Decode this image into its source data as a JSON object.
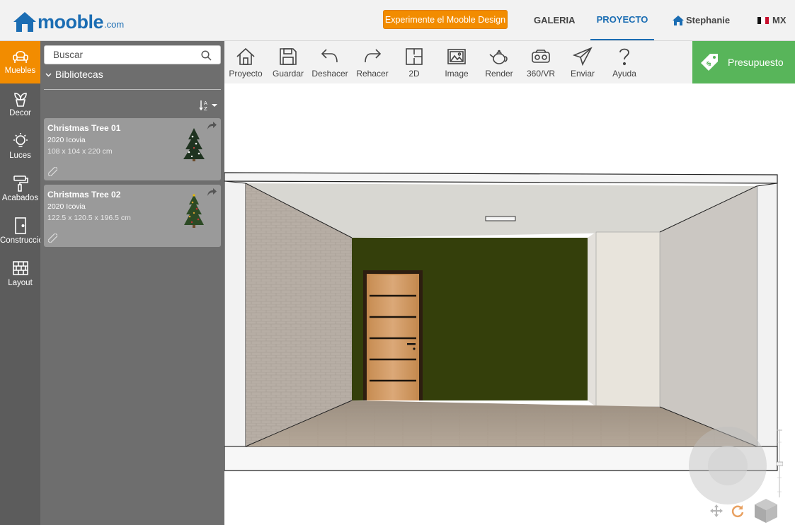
{
  "header": {
    "logo_text": "mooble",
    "logo_suffix": ".com",
    "promo_button": "Experimente el Mooble Design",
    "nav": {
      "galeria": "GALERIA",
      "proyecto": "PROYECTO",
      "user": "Stephanie",
      "country": "MX"
    }
  },
  "leftbar": {
    "items": [
      {
        "label": "Muebles",
        "icon": "armchair-icon",
        "active": true
      },
      {
        "label": "Decor",
        "icon": "plant-icon",
        "active": false
      },
      {
        "label": "Luces",
        "icon": "lightbulb-icon",
        "active": false
      },
      {
        "label": "Acabados",
        "icon": "paint-roller-icon",
        "active": false
      },
      {
        "label": "Construcción",
        "icon": "door-icon",
        "active": false
      },
      {
        "label": "Layout",
        "icon": "brick-wall-icon",
        "active": false
      }
    ]
  },
  "panel": {
    "search_placeholder": "Buscar",
    "library_label": "Bibliotecas",
    "products": [
      {
        "title": "Christmas Tree 01",
        "brand": "2020 Icovia",
        "dims": "108 x 104 x 220 cm"
      },
      {
        "title": "Christmas Tree 02",
        "brand": "2020 Icovia",
        "dims": "122.5 x 120.5 x 196.5 cm"
      }
    ]
  },
  "toolbar": {
    "items": [
      {
        "label": "Proyecto",
        "icon": "home-icon"
      },
      {
        "label": "Guardar",
        "icon": "save-icon"
      },
      {
        "label": "Deshacer",
        "icon": "undo-icon"
      },
      {
        "label": "Rehacer",
        "icon": "redo-icon"
      },
      {
        "label": "2D",
        "icon": "floorplan-icon"
      },
      {
        "label": "Image",
        "icon": "image-icon"
      },
      {
        "label": "Render",
        "icon": "teapot-icon"
      },
      {
        "label": "360/VR",
        "icon": "vr-headset-icon"
      },
      {
        "label": "Enviar",
        "icon": "paper-plane-icon"
      },
      {
        "label": "Ayuda",
        "icon": "question-icon"
      }
    ],
    "budget_button": "Presupuesto"
  },
  "colors": {
    "accent_orange": "#f28c00",
    "brand_blue": "#1b6db3",
    "budget_green": "#58b55a",
    "back_wall": "#343f0b"
  }
}
